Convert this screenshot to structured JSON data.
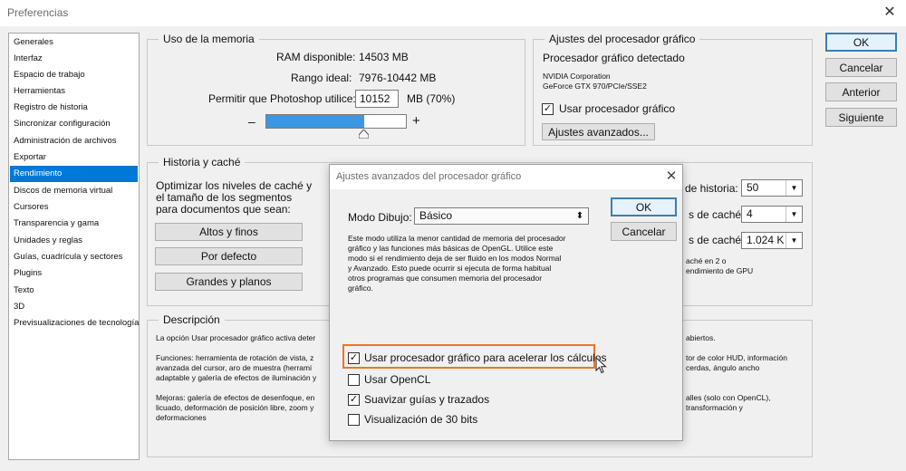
{
  "window": {
    "title": "Preferencias",
    "close_glyph": "✕"
  },
  "sidebar": {
    "items": [
      "Generales",
      "Interfaz",
      "Espacio de trabajo",
      "Herramientas",
      "Registro de historia",
      "Sincronizar configuración",
      "Administración de archivos",
      "Exportar",
      "Rendimiento",
      "Discos de memoria virtual",
      "Cursores",
      "Transparencia y gama",
      "Unidades y reglas",
      "Guías, cuadrícula y sectores",
      "Plugins",
      "Texto",
      "3D",
      "Previsualizaciones de tecnología"
    ],
    "selected": "Rendimiento"
  },
  "buttons": {
    "ok": "OK",
    "cancel": "Cancelar",
    "prev": "Anterior",
    "next": "Siguiente"
  },
  "memory": {
    "title": "Uso de la memoria",
    "ram_label": "RAM disponible:",
    "ram_value": "14503 MB",
    "range_label": "Rango ideal:",
    "range_value": "7976-10442 MB",
    "allow_label": "Permitir que Photoshop utilice:",
    "allow_value": "10152",
    "allow_unit": "MB (70%)",
    "minus": "–",
    "plus": "+",
    "slider_fraction": 0.7
  },
  "gpu": {
    "title": "Ajustes del procesador gráfico",
    "detected": "Procesador gráfico detectado",
    "vendor": "NVIDIA Corporation",
    "model": "GeForce GTX 970/PCIe/SSE2",
    "use_label": "Usar procesador gráfico",
    "use_checked": true,
    "advanced_button": "Ajustes avanzados..."
  },
  "history": {
    "title": "Historia y caché",
    "desc_line1": "Optimizar los niveles de caché y",
    "desc_line2": "el tamaño de los segmentos",
    "desc_line3": "para documentos que sean:",
    "btn_tall": "Altos y finos",
    "btn_default": "Por defecto",
    "btn_big": "Grandes y planos",
    "states_label": "de historia:",
    "states_value": "50",
    "levels_label": "s de caché:",
    "levels_value": "4",
    "tile_label": "s de caché:",
    "tile_value": "1.024 K",
    "note_line1": "aché en 2 o",
    "note_line2": "endimiento de GPU"
  },
  "description": {
    "title": "Descripción",
    "p1_left": "La opción Usar procesador gráfico activa deter",
    "p1_right": "abiertos.",
    "p2_l1": "Funciones: herramienta de rotación de vista, z",
    "p2_l2": "avanzada del cursor, aro de muestra (herrami",
    "p2_l3": "adaptable y galería de efectos de iluminación y",
    "p2_r1": "tor de color HUD, información",
    "p2_r2": "cerdas, ángulo ancho",
    "p3_l1": "Mejoras: galería de efectos de desenfoque, en",
    "p3_l2": "licuado, deformación de posición libre, zoom y",
    "p3_l3": "deformaciones",
    "p3_r1": "alles (solo con OpenCL),",
    "p3_r2": "transformación y"
  },
  "modal": {
    "title": "Ajustes avanzados del procesador gráfico",
    "close_glyph": "✕",
    "ok": "OK",
    "cancel": "Cancelar",
    "mode_label": "Modo Dibujo:",
    "mode_value": "Básico",
    "mode_desc_1": "Este modo utiliza la menor cantidad de memoria del procesador",
    "mode_desc_2": "gráfico y las funciones más básicas de OpenGL. Utilice este",
    "mode_desc_3": "modo si el rendimiento deja de ser fluido en los modos Normal",
    "mode_desc_4": "y Avanzado. Esto puede ocurrir si ejecuta de forma habitual",
    "mode_desc_5": "otros programas que consumen memoria del procesador",
    "mode_desc_6": "gráfico.",
    "opt_compute": "Usar procesador gráfico para acelerar los cálculos",
    "opt_compute_checked": true,
    "opt_opencl": "Usar OpenCL",
    "opt_opencl_checked": false,
    "opt_smooth": "Suavizar guías y trazados",
    "opt_smooth_checked": true,
    "opt_30bit": "Visualización de 30 bits",
    "opt_30bit_checked": false
  },
  "glyphs": {
    "check": "✓",
    "dropdown": "▼",
    "updown": "⬍"
  },
  "colors": {
    "selection": "#0078d7",
    "slider_fill": "#3b97e3",
    "highlight": "#e8772a"
  }
}
